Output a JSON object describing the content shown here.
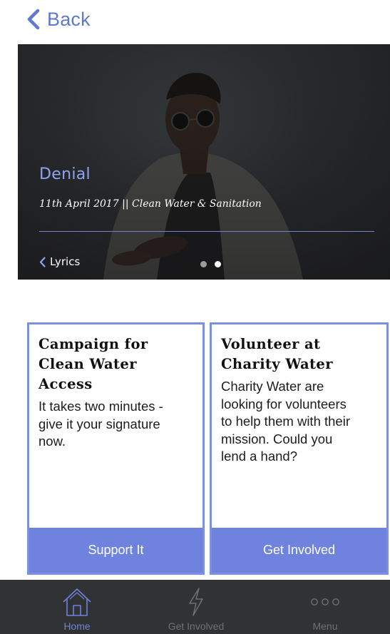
{
  "nav": {
    "back_label": "Back",
    "accent": "#5f79cf"
  },
  "hero": {
    "title": "Denial",
    "subtitle": "11th April 2017 || Clean Water & Sanitation",
    "prev_label": "Lyrics",
    "slides": 2,
    "active_slide": 2
  },
  "cards": [
    {
      "title_lines": [
        "Campaign for",
        "Clean Water",
        "Access"
      ],
      "text_lines": [
        "It takes two minutes -",
        "give it your signature",
        "now."
      ],
      "button_label": "Support It"
    },
    {
      "title_lines": [
        "Volunteer at",
        "Charity Water"
      ],
      "text_lines": [
        "Charity Water are",
        "looking for volunteers",
        "to help them with their",
        "mission. Could you",
        "lend a hand?"
      ],
      "button_label": "Get Involved"
    }
  ],
  "tabbar": {
    "items": [
      {
        "label": "Home",
        "icon": "house-icon",
        "active": true
      },
      {
        "label": "Get Involved",
        "icon": "lightning-icon",
        "active": false
      },
      {
        "label": "Menu",
        "icon": "more-dots-icon",
        "active": false
      }
    ],
    "active_color": "#6f82de",
    "inactive_color": "#6e7073"
  },
  "colors": {
    "accent": "#6f82de",
    "card_border": "#7d90df",
    "tabbar_bg": "#303234"
  }
}
